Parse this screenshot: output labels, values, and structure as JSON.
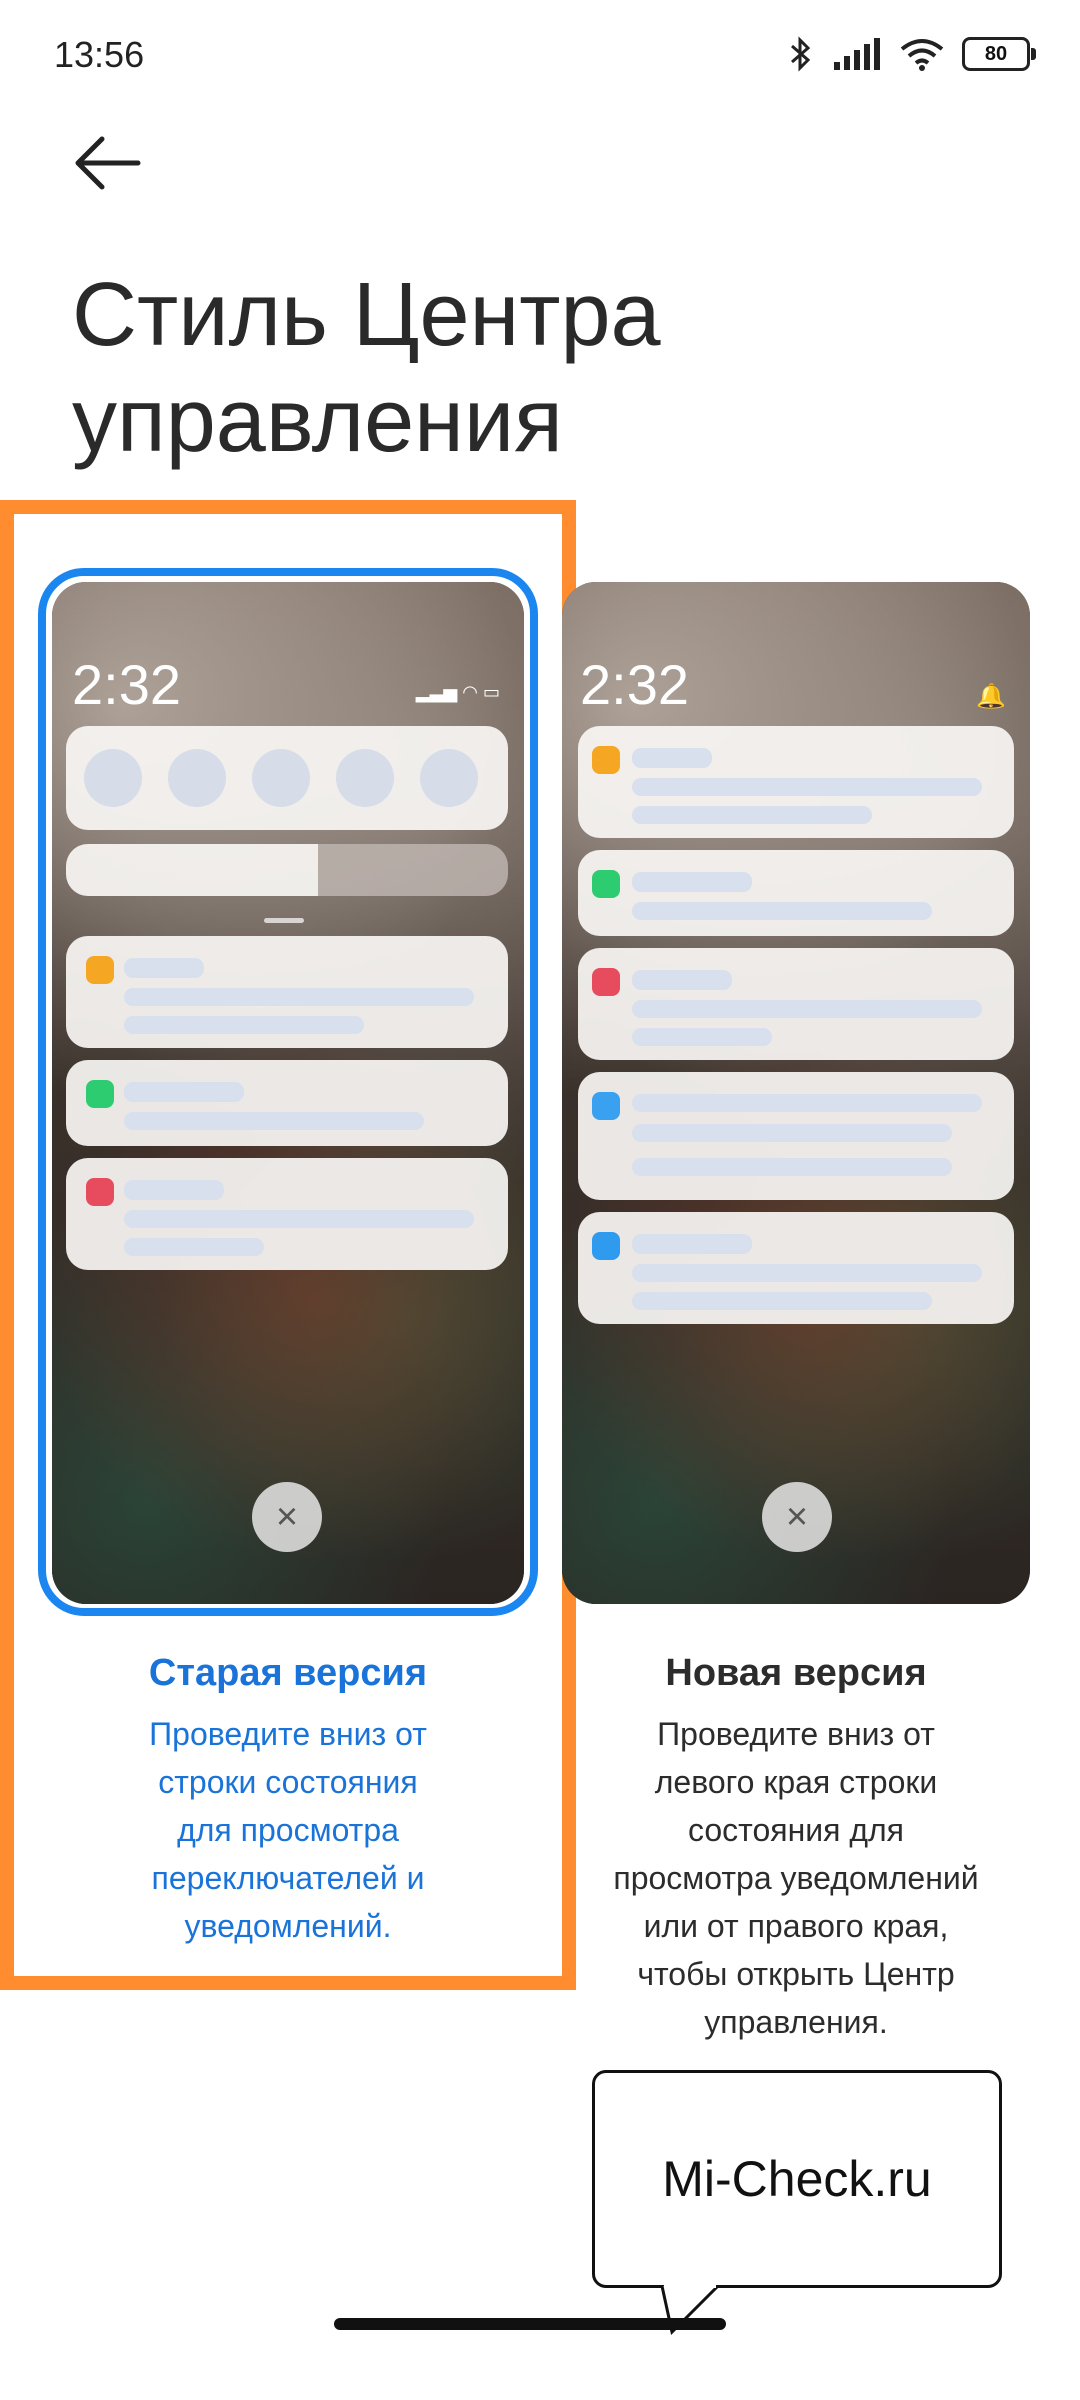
{
  "status_bar": {
    "time": "13:56",
    "battery": "80",
    "icons": [
      "bluetooth-icon",
      "signal-icon",
      "wifi-icon",
      "battery-icon"
    ]
  },
  "header": {
    "title_line1": "Стиль Центра",
    "title_line2": "управления"
  },
  "options": [
    {
      "title": "Старая версия",
      "description": [
        "Проведите вниз от",
        "строки состояния",
        "для просмотра",
        "переключателей и",
        "уведомлений."
      ],
      "selected": true,
      "preview_time": "2:32"
    },
    {
      "title": "Новая версия",
      "description": [
        "Проведите вниз от",
        "левого края строки",
        "состояния для",
        "просмотра уведомлений",
        "или от правого края,",
        "чтобы открыть Центр",
        "управления."
      ],
      "selected": false,
      "preview_time": "2:32"
    }
  ],
  "watermark": "Mi-Check.ru",
  "colors": {
    "accent": "#1a73d9",
    "highlight_frame": "#ff8c2f",
    "selection_ring": "#1c86f0"
  }
}
